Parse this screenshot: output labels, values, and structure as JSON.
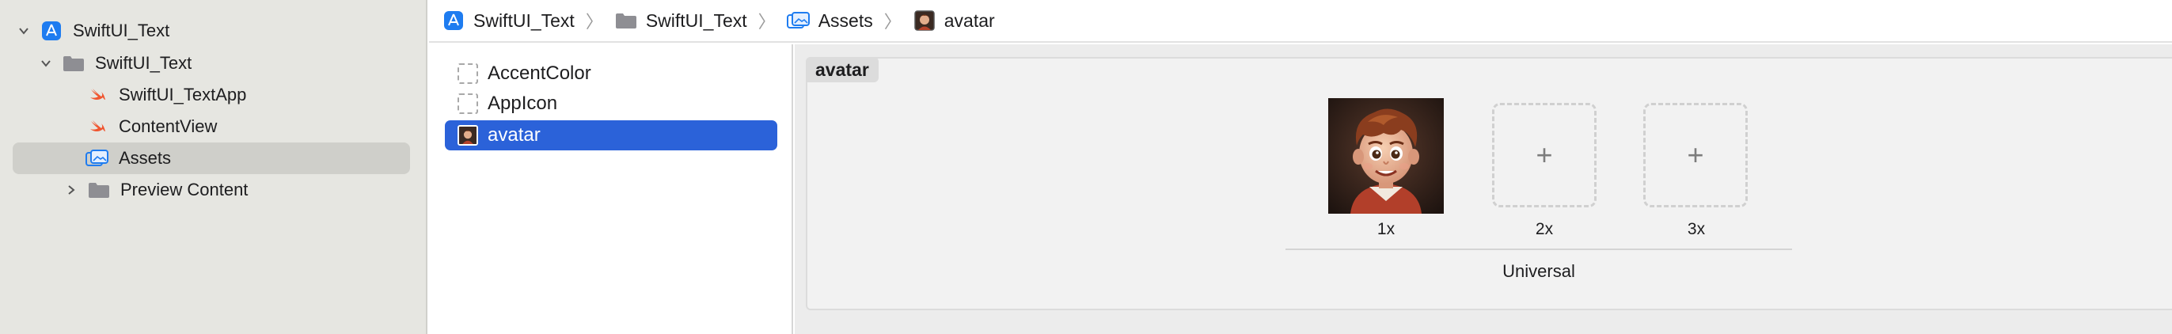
{
  "navigator": {
    "items": [
      {
        "label": "SwiftUI_Text",
        "icon": "app-project-icon",
        "expanded": true
      },
      {
        "label": "SwiftUI_Text",
        "icon": "folder-icon",
        "expanded": true
      },
      {
        "label": "SwiftUI_TextApp",
        "icon": "swift-file-icon"
      },
      {
        "label": "ContentView",
        "icon": "swift-file-icon"
      },
      {
        "label": "Assets",
        "icon": "asset-catalog-icon",
        "selected": true
      },
      {
        "label": "Preview Content",
        "icon": "folder-icon",
        "expanded": false
      }
    ]
  },
  "jumpbar": {
    "crumbs": [
      {
        "label": "SwiftUI_Text",
        "icon": "app-project-icon"
      },
      {
        "label": "SwiftUI_Text",
        "icon": "folder-icon"
      },
      {
        "label": "Assets",
        "icon": "asset-catalog-icon"
      },
      {
        "label": "avatar",
        "icon": "image-set-icon"
      }
    ],
    "separator": "〉"
  },
  "assets": {
    "items": [
      {
        "label": "AccentColor",
        "icon": "color-set-icon"
      },
      {
        "label": "AppIcon",
        "icon": "app-icon-set-icon"
      },
      {
        "label": "avatar",
        "icon": "image-set-icon",
        "selected": true
      }
    ]
  },
  "editor": {
    "set_name": "avatar",
    "slots": [
      {
        "scale": "1x",
        "filled": true
      },
      {
        "scale": "2x",
        "filled": false,
        "symbol": "+"
      },
      {
        "scale": "3x",
        "filled": false,
        "symbol": "+"
      }
    ],
    "idiom": "Universal"
  },
  "colors": {
    "selection": "#2b62d9",
    "navigator_bg": "#e6e6e1",
    "swift_orange": "#f0552f",
    "accent_blue": "#1e7cf0"
  }
}
